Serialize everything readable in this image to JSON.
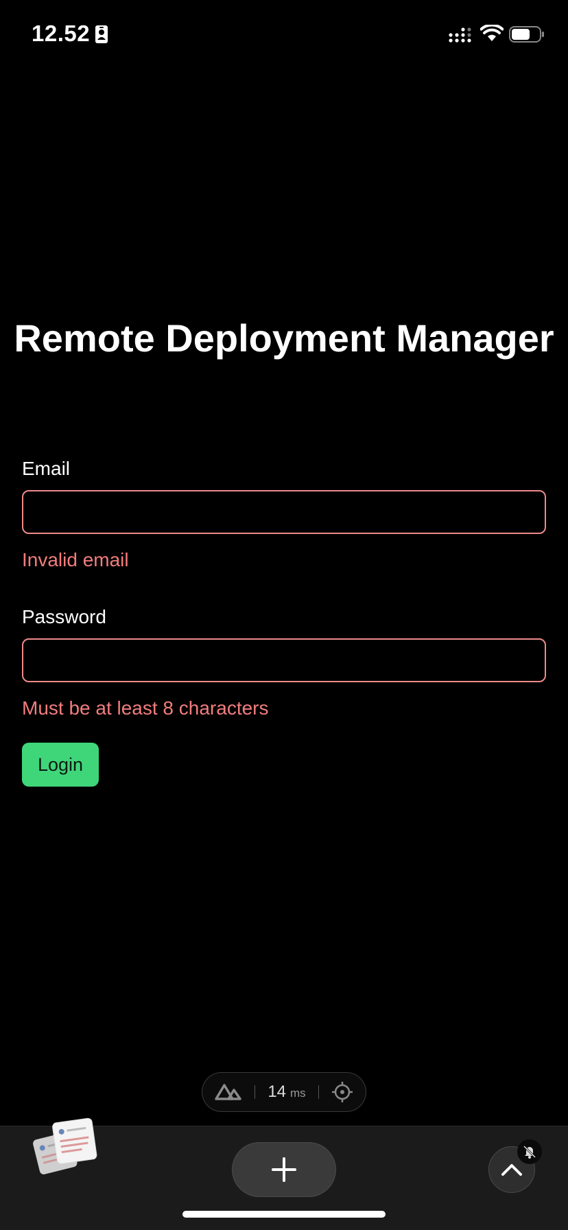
{
  "status_bar": {
    "time": "12.52",
    "icons": [
      "id-badge-icon",
      "cellular-signal-icon",
      "wifi-icon",
      "battery-icon"
    ]
  },
  "page": {
    "title": "Remote Deployment Manager"
  },
  "form": {
    "email": {
      "label": "Email",
      "value": "",
      "error": "Invalid email"
    },
    "password": {
      "label": "Password",
      "value": "",
      "error": "Must be at least 8 characters"
    },
    "login_label": "Login"
  },
  "dev_toolbar": {
    "logo": "nuxt-logo-icon",
    "timing_value": "14",
    "timing_unit": "ms",
    "inspect": "crosshair-icon"
  },
  "bottom_bar": {
    "thumbnail": "tab-thumbnails",
    "add": "plus-icon",
    "scroll_up": "chevron-up-icon",
    "badge": "muted-icon"
  },
  "colors": {
    "background": "#000000",
    "error": "#f27d7d",
    "input_border": "#f08b8b",
    "accent": "#3fd67a"
  }
}
